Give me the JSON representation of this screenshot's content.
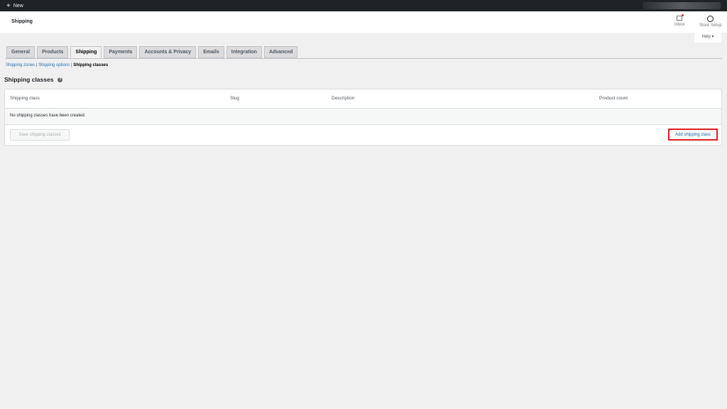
{
  "adminbar": {
    "new_label": "New"
  },
  "header": {
    "title": "Shipping",
    "inbox": "Inbox",
    "store_setup": "Store Setup",
    "help": "Help"
  },
  "tabs": [
    "General",
    "Products",
    "Shipping",
    "Payments",
    "Accounts & Privacy",
    "Emails",
    "Integration",
    "Advanced"
  ],
  "subnav": {
    "zones": "Shipping zones",
    "options": "Shipping options",
    "classes": "Shipping classes",
    "sep": "|"
  },
  "section": {
    "title": "Shipping classes",
    "help": "?"
  },
  "table": {
    "columns": [
      "Shipping class",
      "Slug",
      "Description",
      "Product count"
    ],
    "empty": "No shipping classes have been created."
  },
  "buttons": {
    "save": "Save shipping classes",
    "add": "Add shipping class"
  }
}
